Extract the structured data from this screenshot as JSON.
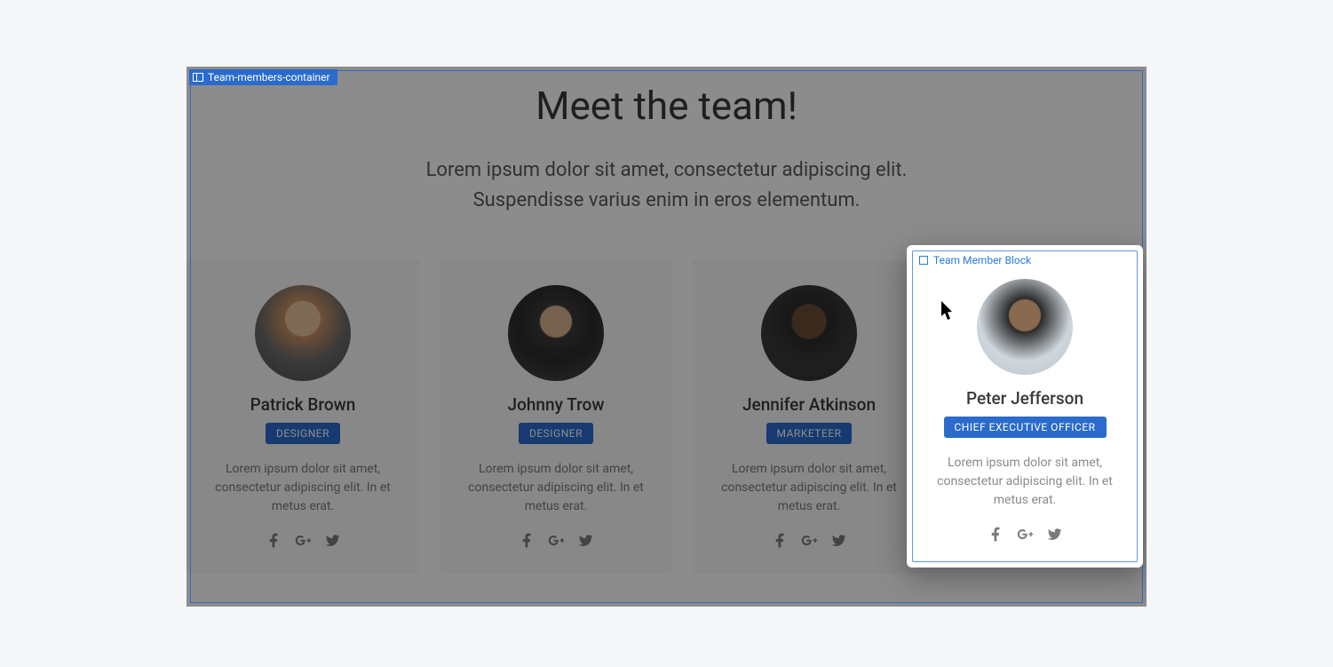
{
  "container_label": "Team-members-container",
  "selected_label": "Team Member Block",
  "heading": "Meet the team!",
  "subheading_line1": "Lorem ipsum dolor sit amet, consectetur adipiscing elit.",
  "subheading_line2": "Suspendisse varius enim in eros elementum.",
  "bio": "Lorem ipsum dolor sit amet, consectetur adipiscing elit. In et metus erat.",
  "members": [
    {
      "name": "Patrick Brown",
      "role": "DESIGNER"
    },
    {
      "name": "Johnny Trow",
      "role": "DESIGNER"
    },
    {
      "name": "Jennifer Atkinson",
      "role": "MARKETEER"
    },
    {
      "name": "Peter Jefferson",
      "role": "CHIEF EXECUTIVE OFFICER"
    }
  ],
  "social_icons": [
    "facebook",
    "google-plus",
    "twitter"
  ]
}
